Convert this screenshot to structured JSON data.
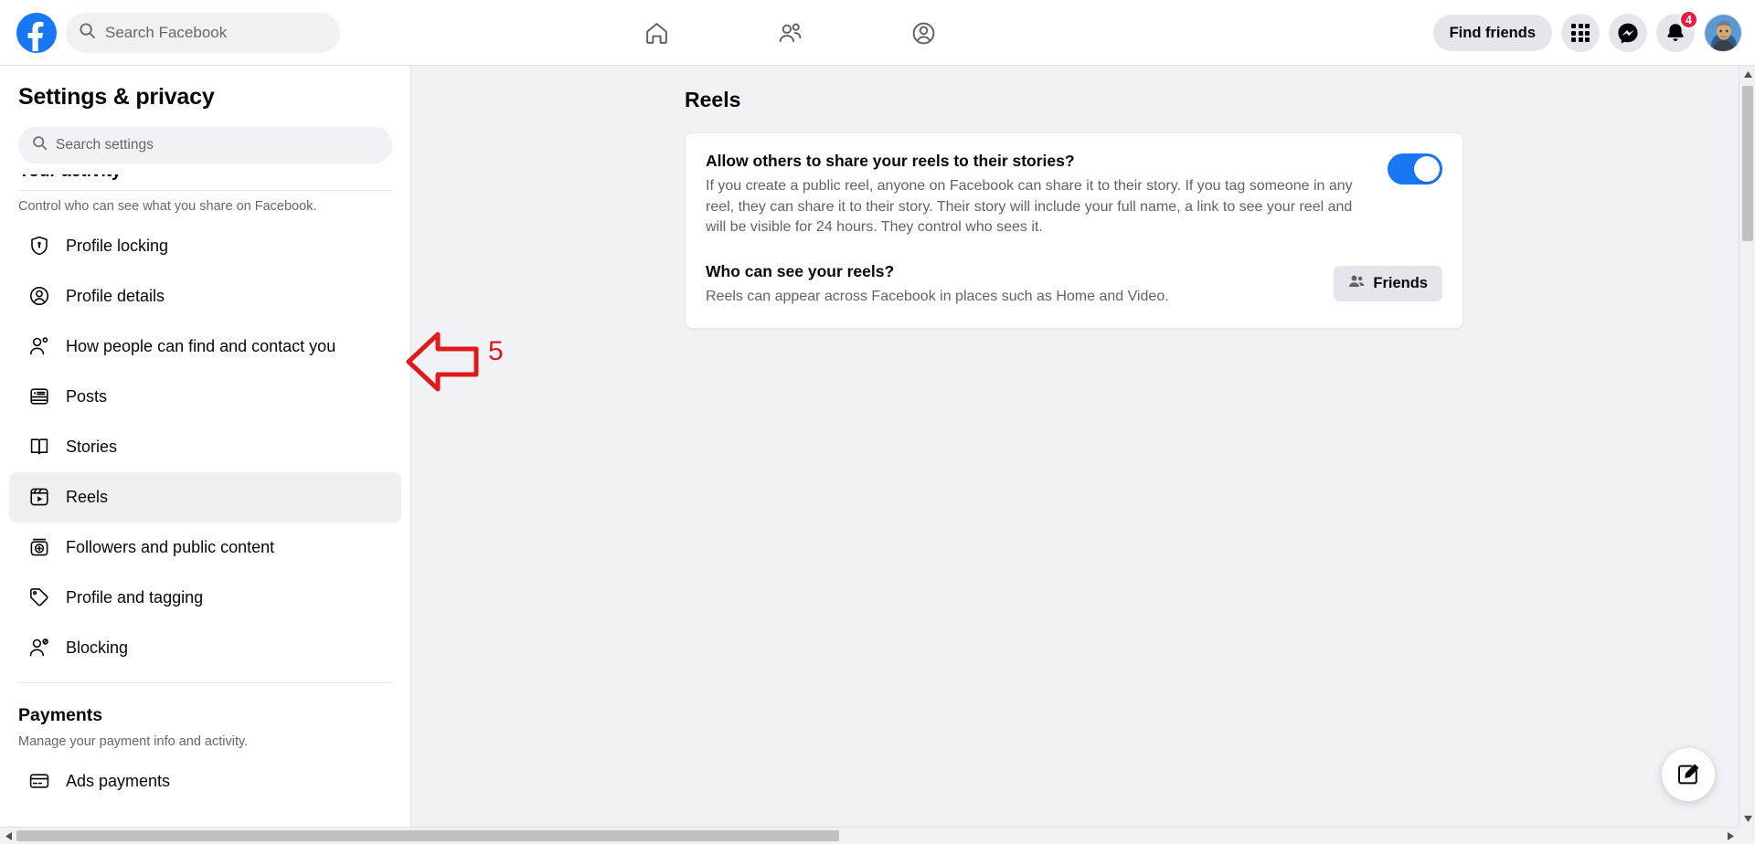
{
  "header": {
    "logo_alt": "facebook-logo",
    "search_placeholder": "Search Facebook",
    "search_value": "",
    "nav_icons": [
      {
        "name": "home-icon",
        "label": "Home"
      },
      {
        "name": "friends-icon",
        "label": "Friends"
      },
      {
        "name": "profile-circle-icon",
        "label": "Profile"
      }
    ],
    "find_friends_label": "Find friends",
    "menu_grid_label": "Menu",
    "messenger_label": "Messenger",
    "notifications_label": "Notifications",
    "notifications_count": "4",
    "account_label": "Your profile"
  },
  "sidebar": {
    "title": "Settings & privacy",
    "search_placeholder": "Search settings",
    "search_value": "",
    "clipped_heading": "Your activity",
    "privacy_subtitle": "Control who can see what you share on Facebook.",
    "items": [
      {
        "label": "Profile locking",
        "icon": "shield-lock-icon",
        "active": false
      },
      {
        "label": "Profile details",
        "icon": "profile-circle-icon",
        "active": false
      },
      {
        "label": "How people can find and contact you",
        "icon": "person-search-icon",
        "active": false
      },
      {
        "label": "Posts",
        "icon": "posts-icon",
        "active": false
      },
      {
        "label": "Stories",
        "icon": "stories-book-icon",
        "active": false
      },
      {
        "label": "Reels",
        "icon": "reels-icon",
        "active": true
      },
      {
        "label": "Followers and public content",
        "icon": "followers-plus-icon",
        "active": false
      },
      {
        "label": "Profile and tagging",
        "icon": "tag-icon",
        "active": false
      },
      {
        "label": "Blocking",
        "icon": "person-block-icon",
        "active": false
      }
    ],
    "payments": {
      "heading": "Payments",
      "subtitle": "Manage your payment info and activity.",
      "items": [
        {
          "label": "Ads payments",
          "icon": "credit-card-icon"
        }
      ]
    }
  },
  "main": {
    "title": "Reels",
    "settings": [
      {
        "title": "Allow others to share your reels to their stories?",
        "description": "If you create a public reel, anyone on Facebook can share it to their story. If you tag someone in any reel, they can share it to their story. Their story will include your full name, a link to see your reel and will be visible for 24 hours. They control who sees it.",
        "control": "toggle",
        "toggle_on": true
      },
      {
        "title": "Who can see your reels?",
        "description": "Reels can appear across Facebook in places such as Home and Video.",
        "control": "audience",
        "audience_label": "Friends",
        "audience_icon": "friends-icon"
      }
    ]
  },
  "annotation": {
    "number": "5",
    "arrow_direction": "left",
    "color": "#e01a1a",
    "target": "How people can find and contact you"
  },
  "fab": {
    "name": "compose-icon",
    "label": "Create"
  },
  "colors": {
    "brand_blue": "#1877f2",
    "toggle_on": "#1877f2",
    "badge_red": "#e41e3f",
    "annotation_red": "#e01a1a",
    "page_bg": "#f0f2f5",
    "card_bg": "#ffffff",
    "button_grey": "#e4e6eb"
  }
}
